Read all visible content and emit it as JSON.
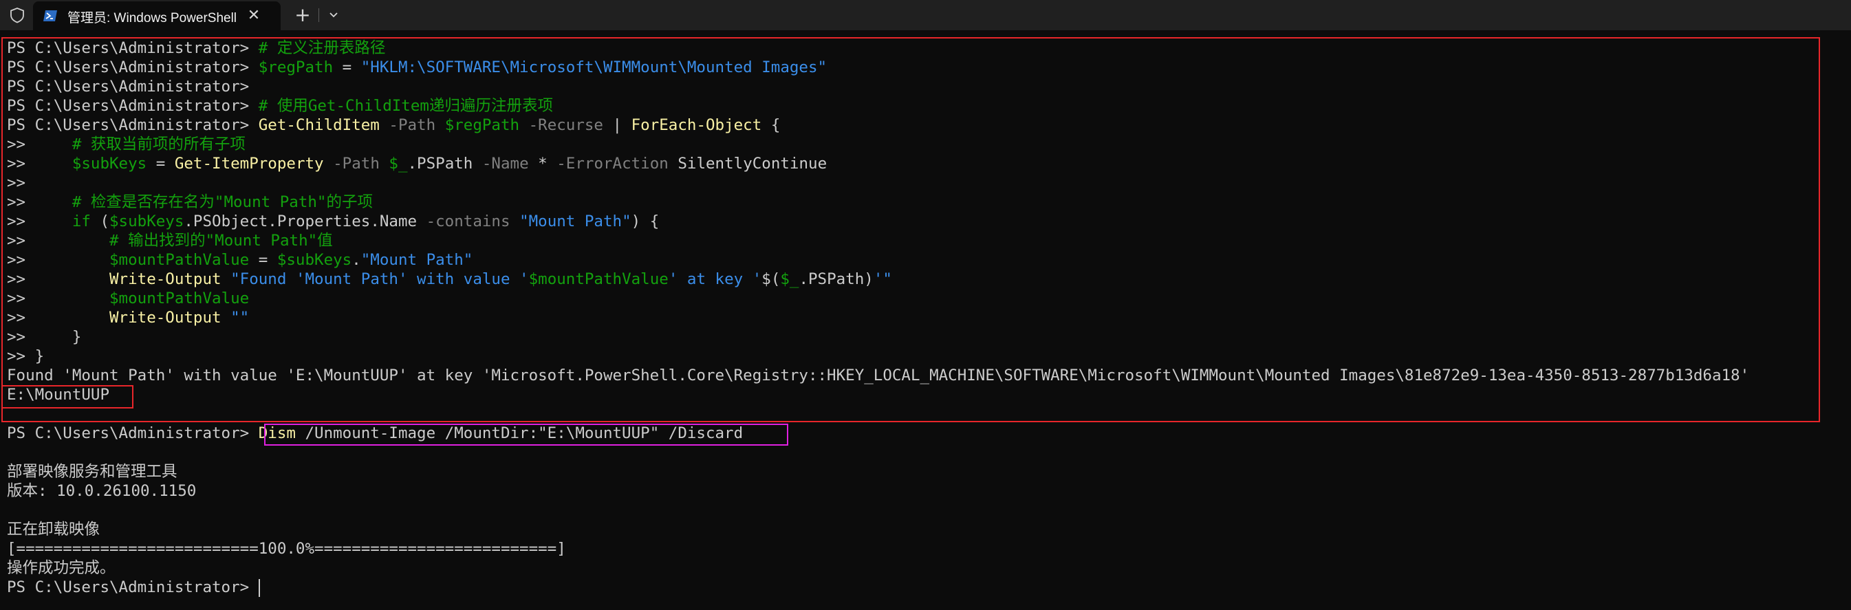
{
  "window": {
    "tab_title": "管理员: Windows PowerShell",
    "close_glyph": "✕",
    "new_tab_glyph": "+",
    "icons": [
      "shield-icon",
      "powershell-icon",
      "close-icon",
      "plus-icon",
      "chevron-down-icon"
    ]
  },
  "colors": {
    "background": "#0c0c0c",
    "tabbar": "#202020",
    "prompt": "#cccccc",
    "comment": "#13a10e",
    "variable": "#13a10e",
    "string": "#3b8eea",
    "command": "#f9f1a5",
    "parameter": "#808080",
    "highlight_red": "#e8262a",
    "highlight_magenta": "#e020e0"
  },
  "terminal": {
    "prompt": "PS C:\\Users\\Administrator> ",
    "cont": ">> ",
    "l1_comment": "# 定义注册表路径",
    "l2_var": "$regPath",
    "l2_eq": " = ",
    "l2_str": "\"HKLM:\\SOFTWARE\\Microsoft\\WIMMount\\Mounted Images\"",
    "l4_comment": "# 使用Get-ChildItem递归遍历注册表项",
    "l5_cmd": "Get-ChildItem",
    "l5_p1": " -Path ",
    "l5_var": "$regPath",
    "l5_p2": " -Recurse",
    "l5_pipe": " | ",
    "l5_cmd2": "ForEach-Object",
    "l5_brace": " {",
    "l6_comment": "    # 获取当前项的所有子项",
    "l7_var": "    $subKeys",
    "l7_eq": " = ",
    "l7_cmd": "Get-ItemProperty",
    "l7_p1": " -Path ",
    "l7_var2": "$_",
    "l7_prop": ".PSPath",
    "l7_p2": " -Name ",
    "l7_star": "*",
    "l7_p3": " -ErrorAction ",
    "l7_val": "SilentlyContinue",
    "l9_comment": "    # 检查是否存在名为\"Mount Path\"的子项",
    "l10_kw": "    if",
    "l10_paren": " (",
    "l10_var": "$subKeys",
    "l10_prop": ".PSObject.Properties.Name",
    "l10_op": " -contains ",
    "l10_str": "\"Mount Path\"",
    "l10_end": ") {",
    "l11_comment": "        # 输出找到的\"Mount Path\"值",
    "l12_var": "        $mountPathValue",
    "l12_eq": " = ",
    "l12_var2": "$subKeys",
    "l12_dot": ".",
    "l12_str": "\"Mount Path\"",
    "l13_cmd": "        Write-Output",
    "l13_s1": " \"Found 'Mount Path' with value '",
    "l13_v1": "$mountPathValue",
    "l13_s2": "' at key '",
    "l13_sub": "$(",
    "l13_v2": "$_",
    "l13_prop": ".PSPath",
    "l13_close": ")",
    "l13_s3": "'\"",
    "l14_var": "        $mountPathValue",
    "l15_cmd": "        Write-Output",
    "l15_str": " \"\"",
    "l16_brace": "    }",
    "l17_brace": "}",
    "out_found": "Found 'Mount Path' with value 'E:\\MountUUP' at key 'Microsoft.PowerShell.Core\\Registry::HKEY_LOCAL_MACHINE\\SOFTWARE\\Microsoft\\WIMMount\\Mounted Images\\81e872e9-13ea-4350-8513-2877b13d6a18'",
    "out_value": "E:\\MountUUP",
    "dism_cmd": "Dism",
    "dism_args": " /Unmount-Image /MountDir:\"E:\\MountUUP\" /Discard",
    "dism_title": "部署映像服务和管理工具",
    "dism_version": "版本: 10.0.26100.1150",
    "dism_unmounting": "正在卸载映像",
    "dism_progress": "[==========================100.0%==========================]",
    "dism_done": "操作成功完成。",
    "progress_percent": 100.0
  }
}
